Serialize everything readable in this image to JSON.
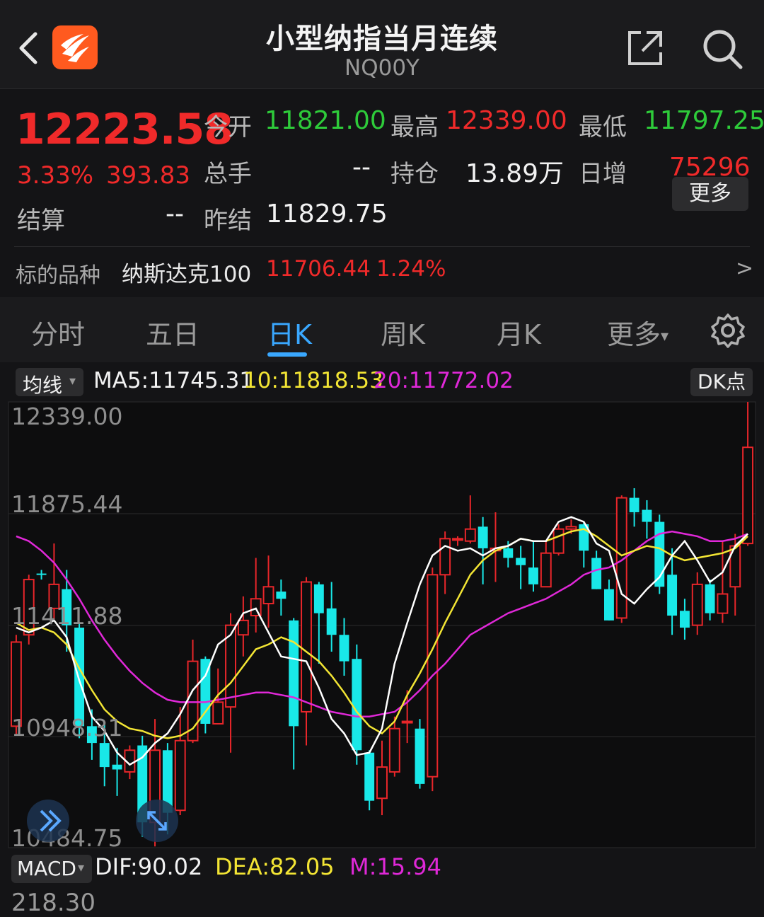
{
  "header": {
    "title": "小型纳指当月连续",
    "code": "NQ00Y"
  },
  "quote": {
    "last_price": "12223.58",
    "change_pct": "3.33%",
    "change_abs": "393.83",
    "open_label": "今开",
    "open_value": "11821.00",
    "high_label": "最高",
    "high_value": "12339.00",
    "low_label": "最低",
    "low_value": "11797.25",
    "volume_label": "总手",
    "volume_value": "--",
    "oi_label": "持仓",
    "oi_value": "13.89万",
    "daily_inc_label": "日增",
    "daily_inc_value": "75296",
    "settle_label": "结算",
    "settle_value": "--",
    "prev_settle_label": "昨结",
    "prev_settle_value": "11829.75",
    "more_label": "更多"
  },
  "underlying": {
    "label": "标的品种",
    "name": "纳斯达克100",
    "price": "11706.44",
    "pct": "1.24%",
    "arrow": ">"
  },
  "tabs": {
    "items": [
      "分时",
      "五日",
      "日K",
      "周K",
      "月K",
      "更多"
    ],
    "active": "日K",
    "more_caret": "▾"
  },
  "ma_bar": {
    "selector_label": "均线",
    "ma5": "MA5:11745.31",
    "ma10": "10:11818.53",
    "ma20": "20:11772.02",
    "dk_label": "DK点"
  },
  "chart_data": {
    "type": "candlestick",
    "y_ticks": [
      "12339.00",
      "11875.44",
      "11411.88",
      "10948.31",
      "10484.75"
    ],
    "ylim": [
      10484.75,
      12339.0
    ],
    "colors": {
      "up": "#e8262a",
      "down": "#19e8e8",
      "ma5": "#ffffff",
      "ma10": "#f3e534",
      "ma20": "#e028d8"
    },
    "candles": [
      [
        10990,
        11340,
        10950,
        11370
      ],
      [
        11370,
        11600,
        11330,
        11620
      ],
      [
        11625,
        11620,
        11600,
        11640
      ],
      [
        11480,
        11580,
        11430,
        11750
      ],
      [
        11560,
        11410,
        11300,
        11640
      ],
      [
        11400,
        10990,
        10940,
        11420
      ],
      [
        10990,
        10920,
        10850,
        11060
      ],
      [
        10920,
        10820,
        10740,
        11000
      ],
      [
        10830,
        10810,
        10700,
        10900
      ],
      [
        10800,
        10890,
        10770,
        10910
      ],
      [
        10910,
        10590,
        10530,
        10950
      ],
      [
        10590,
        10890,
        10490,
        11020
      ],
      [
        10890,
        10630,
        10540,
        10920
      ],
      [
        10640,
        10930,
        10620,
        11070
      ],
      [
        10930,
        11260,
        10920,
        11350
      ],
      [
        11270,
        11000,
        10960,
        11280
      ],
      [
        11000,
        11090,
        11030,
        11230
      ],
      [
        11070,
        11410,
        10880,
        11460
      ],
      [
        11370,
        11430,
        11280,
        11530
      ],
      [
        11450,
        11520,
        11380,
        11690
      ],
      [
        11500,
        11570,
        11400,
        11700
      ],
      [
        11550,
        11520,
        11450,
        11600
      ],
      [
        11430,
        10990,
        10810,
        11440
      ],
      [
        11050,
        11590,
        10910,
        11610
      ],
      [
        11580,
        11460,
        11250,
        11590
      ],
      [
        11480,
        11370,
        11300,
        11590
      ],
      [
        11370,
        11260,
        11200,
        11440
      ],
      [
        11270,
        10890,
        10830,
        11330
      ],
      [
        10880,
        10680,
        10640,
        10890
      ],
      [
        10690,
        10820,
        10620,
        10930
      ],
      [
        10800,
        10980,
        10780,
        11030
      ],
      [
        11010,
        11010,
        10920,
        11140
      ],
      [
        10980,
        10750,
        10730,
        11020
      ],
      [
        10780,
        11620,
        10720,
        11650
      ],
      [
        11620,
        11770,
        11540,
        11800
      ],
      [
        11770,
        11770,
        11740,
        11780
      ],
      [
        11760,
        11810,
        11750,
        11950
      ],
      [
        11820,
        11730,
        11580,
        11860
      ],
      [
        11720,
        11730,
        11590,
        11880
      ],
      [
        11730,
        11690,
        11650,
        11760
      ],
      [
        11690,
        11660,
        11560,
        11740
      ],
      [
        11650,
        11580,
        11550,
        11760
      ],
      [
        11570,
        11710,
        11590,
        11760
      ],
      [
        11710,
        11810,
        11700,
        11830
      ],
      [
        11810,
        11820,
        11790,
        11850
      ],
      [
        11830,
        11720,
        11650,
        11840
      ],
      [
        11690,
        11560,
        11560,
        11720
      ],
      [
        11560,
        11430,
        11440,
        11600
      ],
      [
        11440,
        11940,
        11420,
        11950
      ],
      [
        11940,
        11880,
        11820,
        11980
      ],
      [
        11890,
        11840,
        11770,
        11930
      ],
      [
        11840,
        11570,
        11540,
        11870
      ],
      [
        11620,
        11450,
        11370,
        11730
      ],
      [
        11470,
        11400,
        11350,
        11520
      ],
      [
        11410,
        11580,
        11370,
        11630
      ],
      [
        11580,
        11460,
        11430,
        11600
      ],
      [
        11460,
        11540,
        11420,
        11760
      ],
      [
        11570,
        11740,
        11450,
        11790
      ],
      [
        11750,
        12150,
        11740,
        12339
      ]
    ],
    "ma5": [
      11400,
      11380,
      11400,
      11430,
      11360,
      11180,
      11030,
      10970,
      10880,
      10830,
      10860,
      10920,
      10960,
      11040,
      11140,
      11200,
      11330,
      11370,
      11460,
      11480,
      11380,
      11280,
      11270,
      11260,
      11150,
      11020,
      10960,
      10870,
      10880,
      10980,
      11250,
      11420,
      11580,
      11700,
      11740,
      11720,
      11730,
      11700,
      11730,
      11740,
      11770,
      11760,
      11760,
      11840,
      11860,
      11840,
      11750,
      11720,
      11540,
      11500,
      11560,
      11610,
      11700,
      11760,
      11680,
      11590,
      11630,
      11740,
      11790
    ],
    "ma10": [
      11420,
      11390,
      11400,
      11380,
      11330,
      11230,
      11140,
      11060,
      11010,
      10980,
      10970,
      10950,
      10940,
      10950,
      10980,
      11050,
      11120,
      11170,
      11240,
      11310,
      11330,
      11360,
      11340,
      11300,
      11260,
      11200,
      11130,
      11050,
      10990,
      10960,
      11010,
      11120,
      11210,
      11310,
      11420,
      11520,
      11620,
      11680,
      11720,
      11740,
      11770,
      11760,
      11760,
      11780,
      11800,
      11810,
      11780,
      11740,
      11700,
      11720,
      11740,
      11730,
      11700,
      11680,
      11690,
      11700,
      11710,
      11730,
      11780
    ],
    "ma20": [
      11780,
      11760,
      11720,
      11670,
      11600,
      11520,
      11430,
      11350,
      11280,
      11220,
      11170,
      11130,
      11100,
      11090,
      11090,
      11090,
      11100,
      11110,
      11120,
      11130,
      11130,
      11120,
      11110,
      11090,
      11070,
      11050,
      11040,
      11030,
      11030,
      11040,
      11050,
      11090,
      11140,
      11200,
      11250,
      11310,
      11370,
      11400,
      11430,
      11460,
      11480,
      11500,
      11520,
      11550,
      11580,
      11620,
      11640,
      11650,
      11680,
      11720,
      11760,
      11790,
      11800,
      11790,
      11780,
      11760,
      11760,
      11770,
      11790
    ]
  },
  "macd": {
    "selector_label": "MACD",
    "dif": "DIF:90.02",
    "dea": "DEA:82.05",
    "m": "M:15.94",
    "tick": "218.30"
  }
}
